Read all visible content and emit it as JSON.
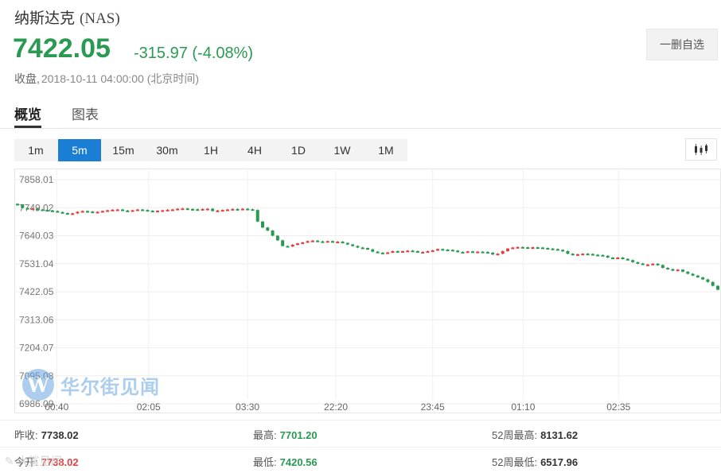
{
  "header": {
    "name": "纳斯达克",
    "code": "(NAS)",
    "price": "7422.05",
    "change": "-315.97 (-4.08%)",
    "close_label": "收盘,",
    "close_time": "2018-10-11 04:00:00 (北京时间)",
    "remove_button": "一删自选"
  },
  "tabs": [
    "概览",
    "图表"
  ],
  "periods": [
    "1m",
    "5m",
    "15m",
    "30m",
    "1H",
    "4H",
    "1D",
    "1W",
    "1M"
  ],
  "active_period": "5m",
  "watermark": {
    "logo": "W",
    "brand": "华尔街见闻"
  },
  "bottom_mark": "✎ 大鲨见闻",
  "chart_data": {
    "type": "candlestick",
    "y_ticks": [
      "7858.01",
      "7749.02",
      "7640.03",
      "7531.04",
      "7422.05",
      "7313.06",
      "7204.07",
      "7095.08",
      "6986.09"
    ],
    "ylim": [
      6986.09,
      7858.01
    ],
    "x_ticks": [
      "00:40",
      "02:05",
      "03:30",
      "22:20",
      "23:45",
      "01:10",
      "02:35"
    ],
    "close_series": [
      7760,
      7748,
      7745,
      7746,
      7742,
      7740,
      7738,
      7736,
      7732,
      7728,
      7725,
      7727,
      7733,
      7736,
      7734,
      7730,
      7733,
      7736,
      7739,
      7741,
      7742,
      7738,
      7736,
      7739,
      7742,
      7740,
      7737,
      7735,
      7737,
      7739,
      7741,
      7742,
      7745,
      7746,
      7744,
      7743,
      7742,
      7744,
      7745,
      7736,
      7738,
      7740,
      7742,
      7744,
      7742,
      7745,
      7743,
      7740,
      7695,
      7672,
      7660,
      7640,
      7622,
      7600,
      7598,
      7605,
      7610,
      7614,
      7619,
      7621,
      7618,
      7616,
      7619,
      7615,
      7617,
      7612,
      7606,
      7600,
      7594,
      7592,
      7587,
      7578,
      7574,
      7572,
      7575,
      7580,
      7578,
      7580,
      7582,
      7580,
      7576,
      7577,
      7580,
      7583,
      7588,
      7586,
      7585,
      7582,
      7577,
      7576,
      7579,
      7577,
      7578,
      7577,
      7574,
      7567,
      7570,
      7580,
      7590,
      7594,
      7596,
      7595,
      7594,
      7595,
      7594,
      7592,
      7590,
      7588,
      7585,
      7580,
      7570,
      7566,
      7568,
      7570,
      7569,
      7566,
      7565,
      7562,
      7555,
      7553,
      7555,
      7550,
      7545,
      7537,
      7532,
      7528,
      7528,
      7531,
      7526,
      7515,
      7510,
      7505,
      7508,
      7500,
      7492,
      7485,
      7478,
      7470,
      7460,
      7445,
      7430
    ]
  },
  "stats": {
    "row1": [
      {
        "label": "昨收:",
        "value": "7738.02",
        "color": "dark"
      },
      {
        "label": "最高:",
        "value": "7701.20",
        "color": "green"
      },
      {
        "label": "52周最高:",
        "value": "8131.62",
        "color": "dark"
      }
    ],
    "row2": [
      {
        "label": "今开:",
        "value": "7738.02",
        "color": "red"
      },
      {
        "label": "最低:",
        "value": "7420.56",
        "color": "green"
      },
      {
        "label": "52周最低:",
        "value": "6517.96",
        "color": "dark"
      }
    ]
  },
  "colors": {
    "up": "#e04141",
    "down": "#2a9a52",
    "accent": "#1a7fd4"
  }
}
